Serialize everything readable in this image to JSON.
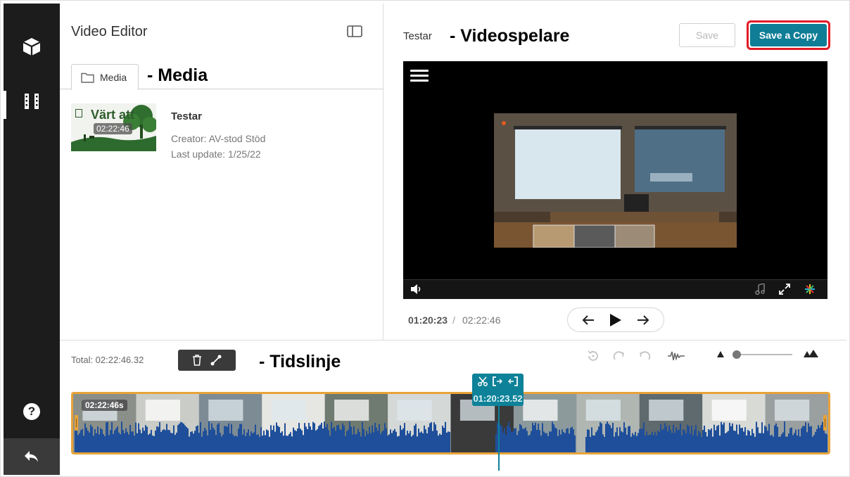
{
  "rail": {
    "items": [
      {
        "icon": "package-icon"
      },
      {
        "icon": "film-strip-icon"
      },
      {
        "icon": "help-icon",
        "label": "?"
      },
      {
        "icon": "back-arrow-icon"
      }
    ]
  },
  "media_panel": {
    "title": "Video Editor",
    "tab_label": "Media",
    "annotation": "- Media",
    "item": {
      "duration": "02:22:46",
      "name": "Testar",
      "creator": "Creator: AV-stod Stöd",
      "last_update": "Last update: 1/25/22",
      "thumb_text": "Värt att"
    }
  },
  "player": {
    "video_name": "Testar",
    "annotation": "- Videospelare",
    "save_label": "Save",
    "save_copy_label": "Save a Copy",
    "current_time": "01:20:23",
    "separator": "/",
    "total_time": "02:22:46"
  },
  "timeline": {
    "total": "Total: 02:22:46.32",
    "annotation": "- Tidslinje",
    "clip_duration": "02:22:46s",
    "playhead_time": "01:20:23.52",
    "playhead_fraction": 0.564,
    "accent": "#e8a33a",
    "playhead_color": "#0e8298",
    "waveform_color": "#1f4f9a"
  },
  "colors": {
    "rail": "#1c1c1c",
    "primary": "#0f7d96",
    "highlight": "#e21b28"
  }
}
